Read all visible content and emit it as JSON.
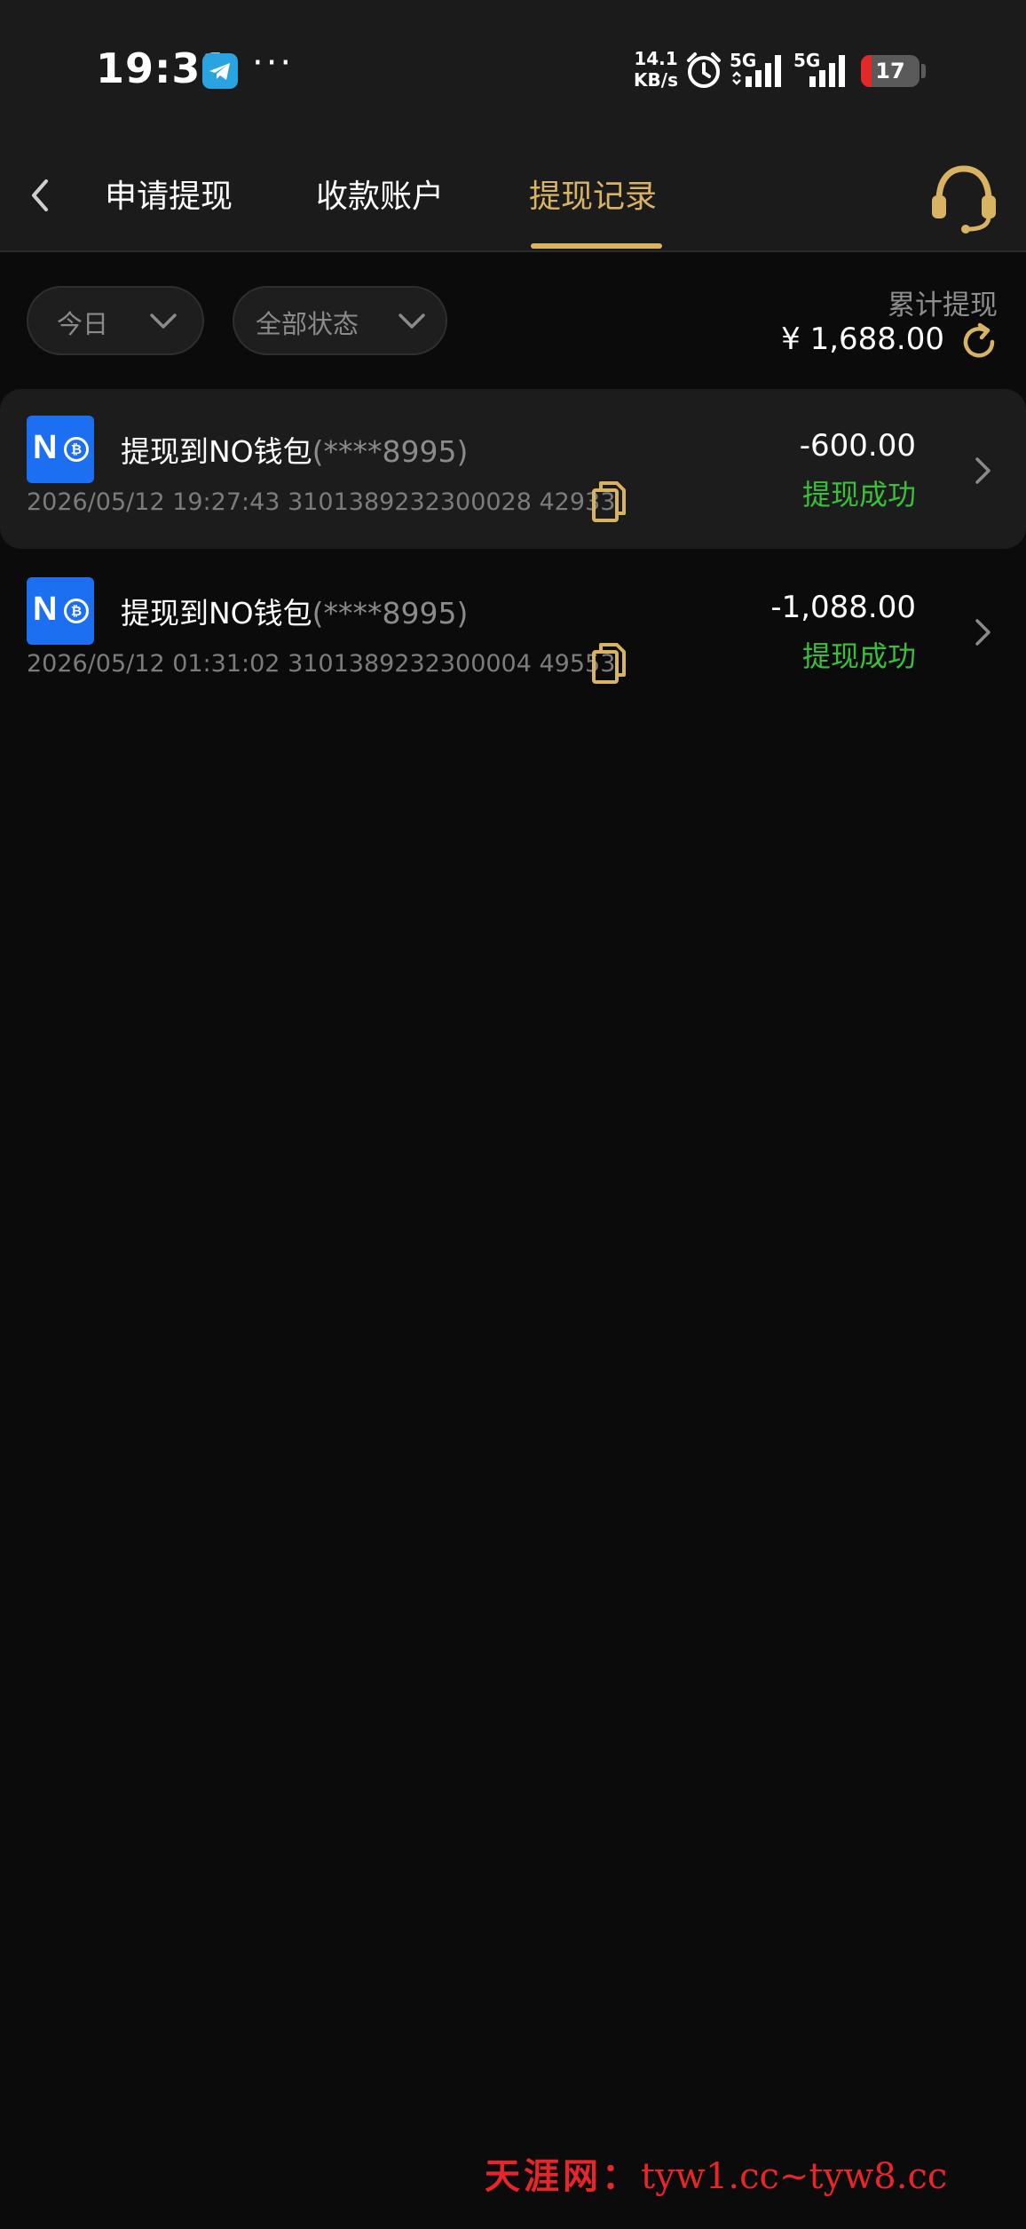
{
  "status_bar": {
    "time": "19:31",
    "net_speed_value": "14.1",
    "net_speed_unit": "KB/s",
    "signal1_label": "5G",
    "signal2_label": "5G",
    "battery": "17",
    "icons": [
      "telegram-icon",
      "more-dots-icon",
      "alarm-icon",
      "signal-icon",
      "battery-icon"
    ]
  },
  "nav": {
    "tabs": [
      {
        "label": "申请提现",
        "active": false
      },
      {
        "label": "收款账户",
        "active": false
      },
      {
        "label": "提现记录",
        "active": true
      }
    ],
    "icons": [
      "back-arrow-icon",
      "headset-support-icon"
    ]
  },
  "filters": {
    "date": "今日",
    "status": "全部状态"
  },
  "summary": {
    "label": "累计提现",
    "amount": "¥ 1,688.00"
  },
  "records": [
    {
      "title": "提现到NO钱包",
      "account_mask": "(****8995)",
      "datetime": "2026/05/12 19:27:43",
      "order_no": "3101389232300028 42933",
      "amount": "-600.00",
      "status": "提现成功"
    },
    {
      "title": "提现到NO钱包",
      "account_mask": "(****8995)",
      "datetime": "2026/05/12 01:31:02",
      "order_no": "3101389232300004 49553",
      "amount": "-1,088.00",
      "status": "提现成功"
    }
  ],
  "watermark": {
    "cn": "天涯网：",
    "urls": "tyw1.cc~tyw8.cc"
  },
  "colors": {
    "accent_gold": "#d9b364",
    "success_green": "#3bbf3b",
    "wallet_blue": "#1d6ff2",
    "background": "#0b0b0b"
  }
}
